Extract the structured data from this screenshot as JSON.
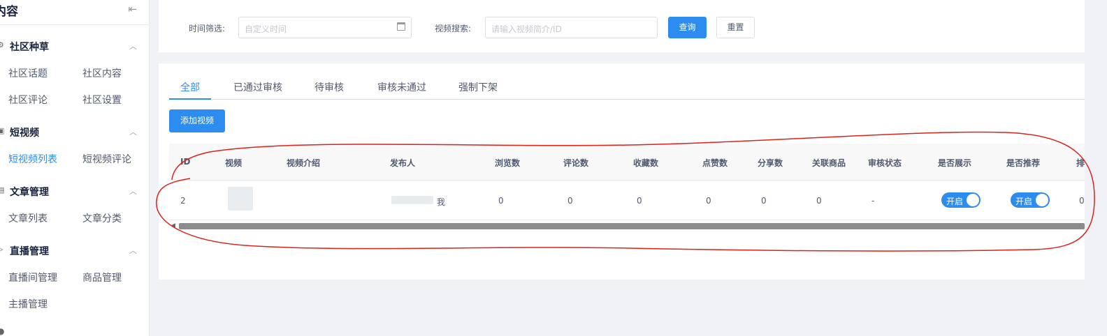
{
  "sidebar": {
    "title": "内容",
    "collapse_icon": "collapse-left-icon",
    "groups": [
      {
        "label": "社区种草",
        "icon": "settings-icon",
        "items": [
          "社区话题",
          "社区内容",
          "社区评论",
          "社区设置"
        ]
      },
      {
        "label": "短视频",
        "icon": "video-icon",
        "items": [
          "短视频列表",
          "短视频评论"
        ]
      },
      {
        "label": "文章管理",
        "icon": "document-icon",
        "items": [
          "文章列表",
          "文章分类"
        ]
      },
      {
        "label": "直播管理",
        "icon": "live-icon",
        "items": [
          "直播间管理",
          "商品管理",
          "主播管理"
        ]
      }
    ],
    "active_item": "短视频列表"
  },
  "filter": {
    "time_label": "时间筛选:",
    "time_placeholder": "自定义时间",
    "search_label": "视频搜索:",
    "search_placeholder": "请输入视频简介/ID",
    "query_label": "查询",
    "reset_label": "重置"
  },
  "tabs": [
    "全部",
    "已通过审核",
    "待审核",
    "审核未通过",
    "强制下架"
  ],
  "active_tab": "全部",
  "add_button": "添加视频",
  "table": {
    "columns": [
      "ID",
      "视频",
      "视频介绍",
      "发布人",
      "浏览数",
      "评论数",
      "收藏数",
      "点赞数",
      "分享数",
      "关联商品",
      "审核状态",
      "是否展示",
      "是否推荐",
      "排"
    ],
    "rows": [
      {
        "id": "2",
        "publisher_suffix": "我",
        "views": "0",
        "comments": "0",
        "favorites": "0",
        "likes": "0",
        "shares": "0",
        "linked_goods": "0",
        "audit_status": "-",
        "show_switch": "开启",
        "recommend_switch": "开启",
        "sort": "0"
      }
    ]
  },
  "colors": {
    "accent": "#2d8cf0",
    "annotation": "#d9231b"
  }
}
